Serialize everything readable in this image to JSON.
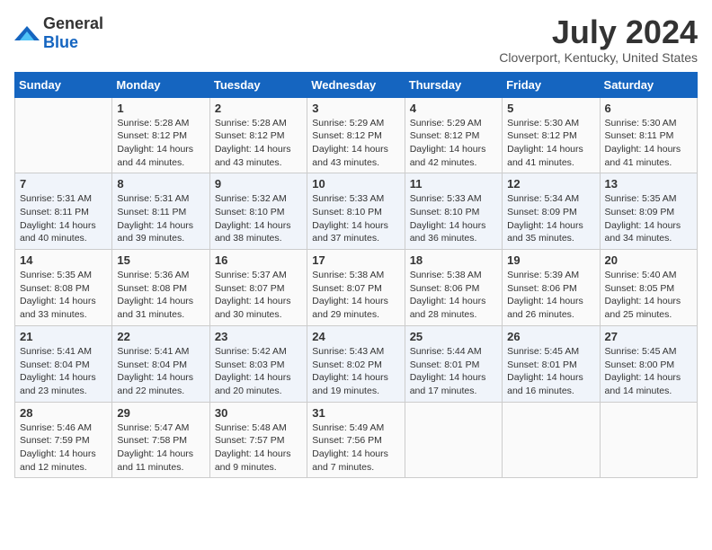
{
  "logo": {
    "text_general": "General",
    "text_blue": "Blue"
  },
  "title": "July 2024",
  "location": "Cloverport, Kentucky, United States",
  "days_of_week": [
    "Sunday",
    "Monday",
    "Tuesday",
    "Wednesday",
    "Thursday",
    "Friday",
    "Saturday"
  ],
  "weeks": [
    [
      {
        "day": "",
        "info": ""
      },
      {
        "day": "1",
        "info": "Sunrise: 5:28 AM\nSunset: 8:12 PM\nDaylight: 14 hours\nand 44 minutes."
      },
      {
        "day": "2",
        "info": "Sunrise: 5:28 AM\nSunset: 8:12 PM\nDaylight: 14 hours\nand 43 minutes."
      },
      {
        "day": "3",
        "info": "Sunrise: 5:29 AM\nSunset: 8:12 PM\nDaylight: 14 hours\nand 43 minutes."
      },
      {
        "day": "4",
        "info": "Sunrise: 5:29 AM\nSunset: 8:12 PM\nDaylight: 14 hours\nand 42 minutes."
      },
      {
        "day": "5",
        "info": "Sunrise: 5:30 AM\nSunset: 8:12 PM\nDaylight: 14 hours\nand 41 minutes."
      },
      {
        "day": "6",
        "info": "Sunrise: 5:30 AM\nSunset: 8:11 PM\nDaylight: 14 hours\nand 41 minutes."
      }
    ],
    [
      {
        "day": "7",
        "info": "Sunrise: 5:31 AM\nSunset: 8:11 PM\nDaylight: 14 hours\nand 40 minutes."
      },
      {
        "day": "8",
        "info": "Sunrise: 5:31 AM\nSunset: 8:11 PM\nDaylight: 14 hours\nand 39 minutes."
      },
      {
        "day": "9",
        "info": "Sunrise: 5:32 AM\nSunset: 8:10 PM\nDaylight: 14 hours\nand 38 minutes."
      },
      {
        "day": "10",
        "info": "Sunrise: 5:33 AM\nSunset: 8:10 PM\nDaylight: 14 hours\nand 37 minutes."
      },
      {
        "day": "11",
        "info": "Sunrise: 5:33 AM\nSunset: 8:10 PM\nDaylight: 14 hours\nand 36 minutes."
      },
      {
        "day": "12",
        "info": "Sunrise: 5:34 AM\nSunset: 8:09 PM\nDaylight: 14 hours\nand 35 minutes."
      },
      {
        "day": "13",
        "info": "Sunrise: 5:35 AM\nSunset: 8:09 PM\nDaylight: 14 hours\nand 34 minutes."
      }
    ],
    [
      {
        "day": "14",
        "info": "Sunrise: 5:35 AM\nSunset: 8:08 PM\nDaylight: 14 hours\nand 33 minutes."
      },
      {
        "day": "15",
        "info": "Sunrise: 5:36 AM\nSunset: 8:08 PM\nDaylight: 14 hours\nand 31 minutes."
      },
      {
        "day": "16",
        "info": "Sunrise: 5:37 AM\nSunset: 8:07 PM\nDaylight: 14 hours\nand 30 minutes."
      },
      {
        "day": "17",
        "info": "Sunrise: 5:38 AM\nSunset: 8:07 PM\nDaylight: 14 hours\nand 29 minutes."
      },
      {
        "day": "18",
        "info": "Sunrise: 5:38 AM\nSunset: 8:06 PM\nDaylight: 14 hours\nand 28 minutes."
      },
      {
        "day": "19",
        "info": "Sunrise: 5:39 AM\nSunset: 8:06 PM\nDaylight: 14 hours\nand 26 minutes."
      },
      {
        "day": "20",
        "info": "Sunrise: 5:40 AM\nSunset: 8:05 PM\nDaylight: 14 hours\nand 25 minutes."
      }
    ],
    [
      {
        "day": "21",
        "info": "Sunrise: 5:41 AM\nSunset: 8:04 PM\nDaylight: 14 hours\nand 23 minutes."
      },
      {
        "day": "22",
        "info": "Sunrise: 5:41 AM\nSunset: 8:04 PM\nDaylight: 14 hours\nand 22 minutes."
      },
      {
        "day": "23",
        "info": "Sunrise: 5:42 AM\nSunset: 8:03 PM\nDaylight: 14 hours\nand 20 minutes."
      },
      {
        "day": "24",
        "info": "Sunrise: 5:43 AM\nSunset: 8:02 PM\nDaylight: 14 hours\nand 19 minutes."
      },
      {
        "day": "25",
        "info": "Sunrise: 5:44 AM\nSunset: 8:01 PM\nDaylight: 14 hours\nand 17 minutes."
      },
      {
        "day": "26",
        "info": "Sunrise: 5:45 AM\nSunset: 8:01 PM\nDaylight: 14 hours\nand 16 minutes."
      },
      {
        "day": "27",
        "info": "Sunrise: 5:45 AM\nSunset: 8:00 PM\nDaylight: 14 hours\nand 14 minutes."
      }
    ],
    [
      {
        "day": "28",
        "info": "Sunrise: 5:46 AM\nSunset: 7:59 PM\nDaylight: 14 hours\nand 12 minutes."
      },
      {
        "day": "29",
        "info": "Sunrise: 5:47 AM\nSunset: 7:58 PM\nDaylight: 14 hours\nand 11 minutes."
      },
      {
        "day": "30",
        "info": "Sunrise: 5:48 AM\nSunset: 7:57 PM\nDaylight: 14 hours\nand 9 minutes."
      },
      {
        "day": "31",
        "info": "Sunrise: 5:49 AM\nSunset: 7:56 PM\nDaylight: 14 hours\nand 7 minutes."
      },
      {
        "day": "",
        "info": ""
      },
      {
        "day": "",
        "info": ""
      },
      {
        "day": "",
        "info": ""
      }
    ]
  ]
}
